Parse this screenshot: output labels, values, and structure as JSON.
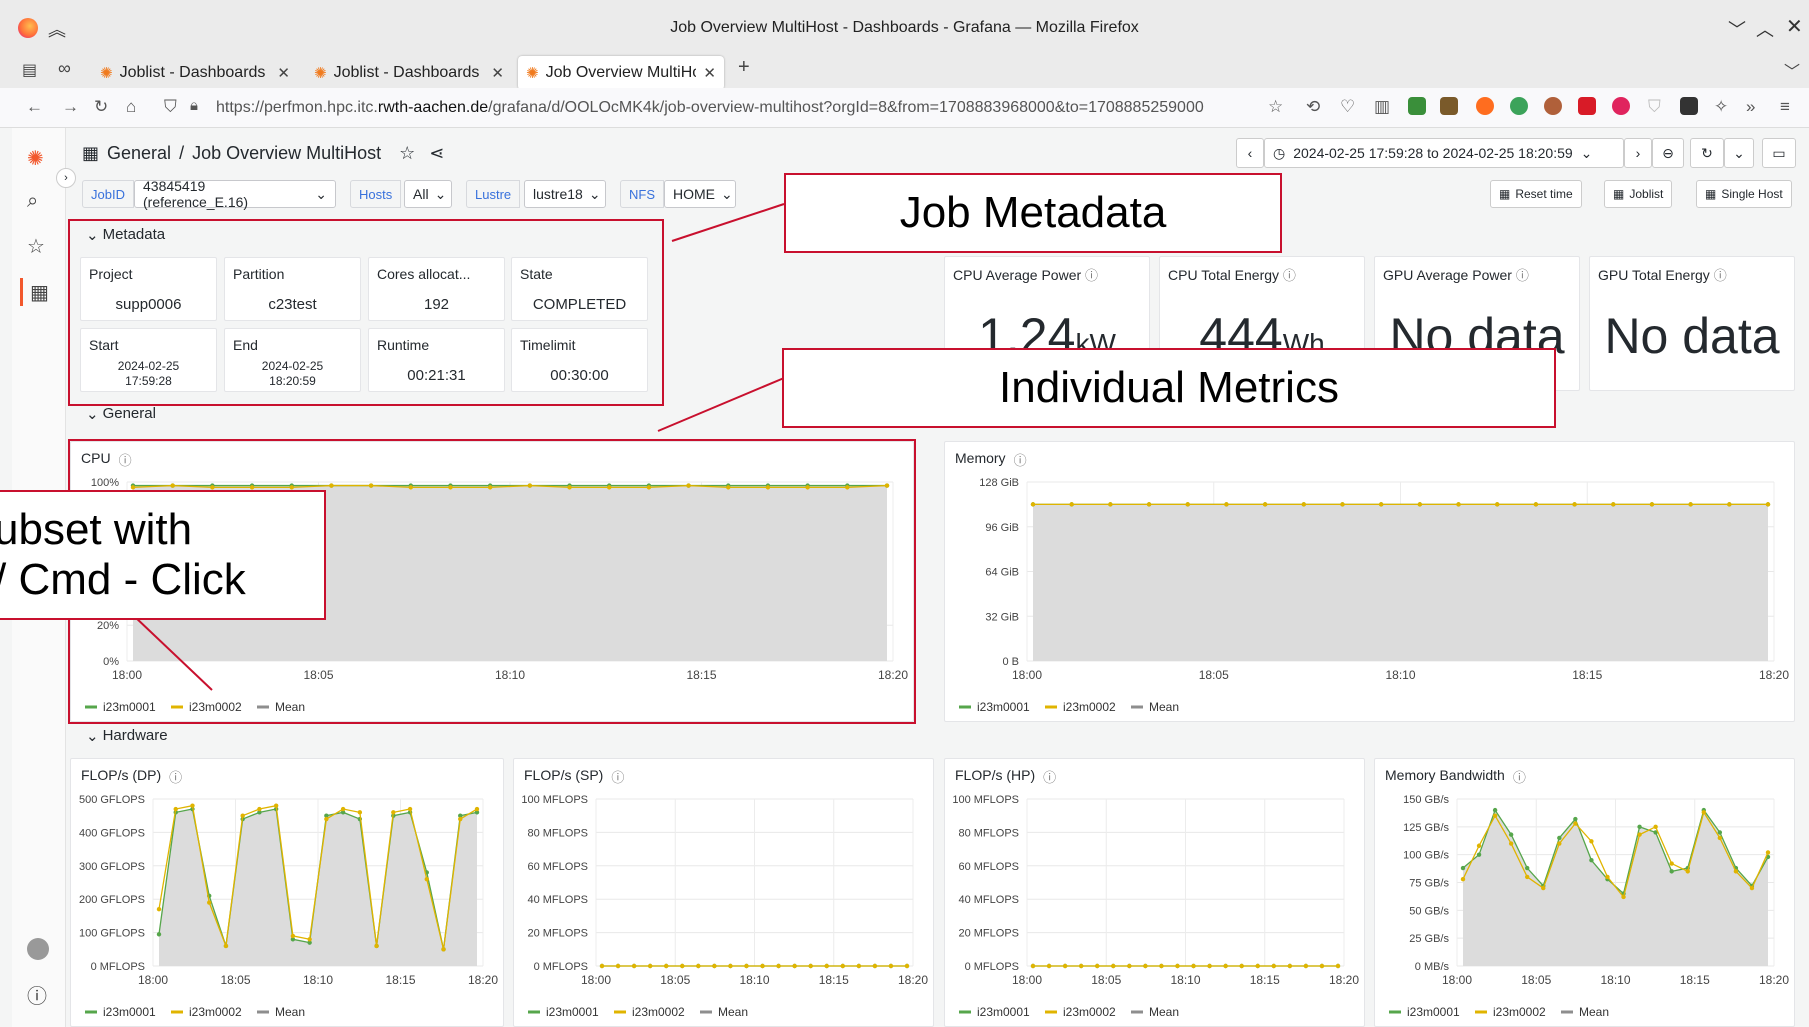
{
  "window": {
    "title": "Job Overview MultiHost - Dashboards - Grafana — Mozilla Firefox"
  },
  "tabs": [
    {
      "label": "Joblist - Dashboards - Gr"
    },
    {
      "label": "Joblist - Dashboards - Gr"
    },
    {
      "label": "Job Overview MultiHost"
    }
  ],
  "url": {
    "prefix": "https://perfmon.hpc.itc.",
    "host": "rwth-aachen.de",
    "path": "/grafana/d/OOLOcMK4k/job-overview-multihost?orgId=8&from=1708883968000&to=1708885259000"
  },
  "breadcrumb": {
    "root": "General",
    "sep": "/",
    "title": "Job Overview MultiHost"
  },
  "timerange": "2024-02-25 17:59:28 to 2024-02-25 18:20:59",
  "vars": {
    "jobid_label": "JobID",
    "jobid_value": "43845419 (reference_E.16)",
    "hosts_label": "Hosts",
    "hosts_value": "All",
    "lustre_label": "Lustre",
    "lustre_value": "lustre18",
    "nfs_label": "NFS",
    "nfs_value": "HOME"
  },
  "buttons": {
    "reset": "Reset time",
    "joblist": "Joblist",
    "single": "Single Host"
  },
  "rows": {
    "metadata": "Metadata",
    "general": "General",
    "hardware": "Hardware"
  },
  "meta": [
    {
      "title": "Project",
      "value": "supp0006"
    },
    {
      "title": "Partition",
      "value": "c23test"
    },
    {
      "title": "Cores allocat...",
      "value": "192"
    },
    {
      "title": "State",
      "value": "COMPLETED"
    },
    {
      "title": "Start",
      "value": "2024-02-25",
      "value2": "17:59:28"
    },
    {
      "title": "End",
      "value": "2024-02-25",
      "value2": "18:20:59"
    },
    {
      "title": "Runtime",
      "value": "00:21:31"
    },
    {
      "title": "Timelimit",
      "value": "00:30:00"
    }
  ],
  "power": [
    {
      "title": "CPU Average Power",
      "value": "1.24",
      "unit": "kW"
    },
    {
      "title": "CPU Total Energy",
      "value": "444",
      "unit": "Wh"
    },
    {
      "title": "GPU Average Power",
      "value": "No data",
      "unit": ""
    },
    {
      "title": "GPU Total Energy",
      "value": "No data",
      "unit": ""
    }
  ],
  "callouts": {
    "job_metadata": "Job Metadata",
    "individual": "Individual Metrics",
    "subset_line1": "ubset with",
    "subset_line2": "/ Cmd - Click"
  },
  "legend": {
    "s1": "i23m0001",
    "s2": "i23m0002",
    "s3": "Mean"
  },
  "colors": {
    "green": "#56a64b",
    "yellow": "#e0b400",
    "gray": "#8e8e8e",
    "accent": "#3871dc",
    "highlight": "#c8102e"
  },
  "chart_data": [
    {
      "name": "cpu",
      "type": "line",
      "title": "CPU",
      "x": [
        "18:00",
        "18:05",
        "18:10",
        "18:15",
        "18:20"
      ],
      "yticks": [
        "100%",
        "20%",
        "0%"
      ],
      "ylim": [
        0,
        100
      ],
      "series": [
        {
          "name": "i23m0001",
          "values": [
            98,
            98,
            98,
            98,
            98,
            98,
            98,
            98,
            98,
            98,
            98,
            98,
            98,
            98,
            98,
            98,
            98,
            98,
            98,
            98
          ]
        },
        {
          "name": "i23m0002",
          "values": [
            97,
            98,
            97,
            97,
            97,
            98,
            98,
            97,
            97,
            97,
            98,
            97,
            97,
            97,
            98,
            97,
            97,
            97,
            97,
            98
          ]
        }
      ]
    },
    {
      "name": "memory",
      "type": "line",
      "title": "Memory",
      "x": [
        "18:00",
        "18:05",
        "18:10",
        "18:15",
        "18:20"
      ],
      "yticks": [
        "128 GiB",
        "96 GiB",
        "64 GiB",
        "32 GiB",
        "0 B"
      ],
      "ylim": [
        0,
        128
      ],
      "series": [
        {
          "name": "i23m0001",
          "values": [
            112,
            112,
            112,
            112,
            112,
            112,
            112,
            112,
            112,
            112,
            112,
            112,
            112,
            112,
            112,
            112,
            112,
            112,
            112,
            112
          ]
        },
        {
          "name": "i23m0002",
          "values": [
            112,
            112,
            112,
            112,
            112,
            112,
            112,
            112,
            112,
            112,
            112,
            112,
            112,
            112,
            112,
            112,
            112,
            112,
            112,
            112
          ]
        }
      ]
    },
    {
      "name": "flops-dp",
      "type": "line",
      "title": "FLOP/s (DP)",
      "x": [
        "18:00",
        "18:05",
        "18:10",
        "18:15",
        "18:20"
      ],
      "yticks": [
        "500 GFLOPS",
        "400 GFLOPS",
        "300 GFLOPS",
        "200 GFLOPS",
        "100 GFLOPS",
        "0 MFLOPS"
      ],
      "ylim": [
        0,
        500
      ],
      "series": [
        {
          "name": "i23m0001",
          "values": [
            95,
            460,
            470,
            210,
            60,
            440,
            460,
            470,
            80,
            70,
            450,
            460,
            440,
            60,
            450,
            460,
            280,
            50,
            450,
            460
          ]
        },
        {
          "name": "i23m0002",
          "values": [
            170,
            470,
            480,
            190,
            60,
            450,
            470,
            480,
            90,
            80,
            440,
            470,
            460,
            60,
            460,
            470,
            260,
            50,
            440,
            470
          ]
        }
      ]
    },
    {
      "name": "flops-sp",
      "type": "line",
      "title": "FLOP/s (SP)",
      "x": [
        "18:00",
        "18:05",
        "18:10",
        "18:15",
        "18:20"
      ],
      "yticks": [
        "100 MFLOPS",
        "80 MFLOPS",
        "60 MFLOPS",
        "40 MFLOPS",
        "20 MFLOPS",
        "0 MFLOPS"
      ],
      "ylim": [
        0,
        100
      ],
      "series": [
        {
          "name": "i23m0001",
          "values": [
            0,
            0,
            0,
            0,
            0,
            0,
            0,
            0,
            0,
            0,
            0,
            0,
            0,
            0,
            0,
            0,
            0,
            0,
            0,
            0
          ]
        },
        {
          "name": "i23m0002",
          "values": [
            0,
            0,
            0,
            0,
            0,
            0,
            0,
            0,
            0,
            0,
            0,
            0,
            0,
            0,
            0,
            0,
            0,
            0,
            0,
            0
          ]
        }
      ]
    },
    {
      "name": "flops-hp",
      "type": "line",
      "title": "FLOP/s (HP)",
      "x": [
        "18:00",
        "18:05",
        "18:10",
        "18:15",
        "18:20"
      ],
      "yticks": [
        "100 MFLOPS",
        "80 MFLOPS",
        "60 MFLOPS",
        "40 MFLOPS",
        "20 MFLOPS",
        "0 MFLOPS"
      ],
      "ylim": [
        0,
        100
      ],
      "series": [
        {
          "name": "i23m0001",
          "values": [
            0,
            0,
            0,
            0,
            0,
            0,
            0,
            0,
            0,
            0,
            0,
            0,
            0,
            0,
            0,
            0,
            0,
            0,
            0,
            0
          ]
        },
        {
          "name": "i23m0002",
          "values": [
            0,
            0,
            0,
            0,
            0,
            0,
            0,
            0,
            0,
            0,
            0,
            0,
            0,
            0,
            0,
            0,
            0,
            0,
            0,
            0
          ]
        }
      ]
    },
    {
      "name": "membw",
      "type": "line",
      "title": "Memory Bandwidth",
      "x": [
        "18:00",
        "18:05",
        "18:10",
        "18:15",
        "18:20"
      ],
      "yticks": [
        "150 GB/s",
        "125 GB/s",
        "100 GB/s",
        "75 GB/s",
        "50 GB/s",
        "25 GB/s",
        "0 MB/s"
      ],
      "ylim": [
        0,
        150
      ],
      "series": [
        {
          "name": "i23m0001",
          "values": [
            88,
            100,
            140,
            118,
            88,
            72,
            115,
            132,
            95,
            78,
            65,
            125,
            120,
            85,
            88,
            140,
            120,
            88,
            72,
            98
          ]
        },
        {
          "name": "i23m0002",
          "values": [
            78,
            108,
            135,
            110,
            80,
            70,
            110,
            128,
            112,
            80,
            62,
            118,
            125,
            92,
            85,
            138,
            115,
            85,
            70,
            102
          ]
        }
      ]
    }
  ]
}
